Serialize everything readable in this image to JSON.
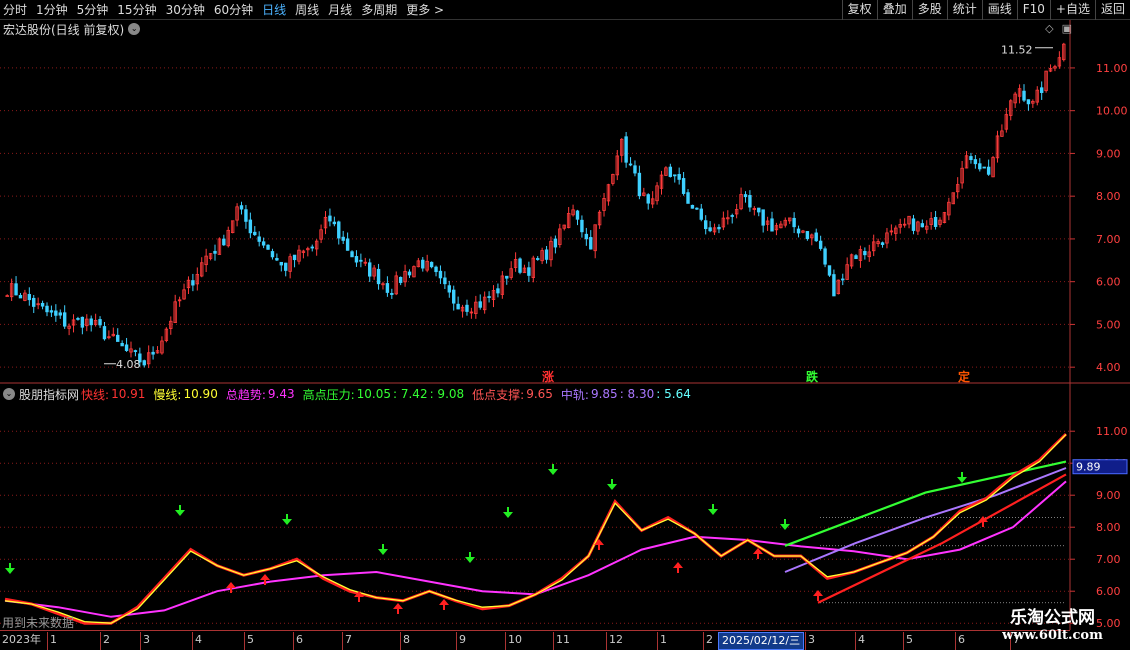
{
  "toolbar": {
    "periods": [
      {
        "label": "分时",
        "active": false
      },
      {
        "label": "1分钟",
        "active": false
      },
      {
        "label": "5分钟",
        "active": false
      },
      {
        "label": "15分钟",
        "active": false
      },
      {
        "label": "30分钟",
        "active": false
      },
      {
        "label": "60分钟",
        "active": false
      },
      {
        "label": "日线",
        "active": true
      },
      {
        "label": "周线",
        "active": false
      },
      {
        "label": "月线",
        "active": false
      },
      {
        "label": "多周期",
        "active": false
      },
      {
        "label": "更多 >",
        "active": false
      }
    ],
    "buttons": [
      "复权",
      "叠加",
      "多股",
      "统计",
      "画线",
      "F10",
      "+自选",
      "返回"
    ]
  },
  "main_chart": {
    "title": "宏达股份(日线 前复权)",
    "high_label": "11.52",
    "low_label": "4.08",
    "event_labels": [
      {
        "text": "涨",
        "color": "#ff3030"
      },
      {
        "text": "跌",
        "color": "#33ff33"
      },
      {
        "text": "定",
        "color": "#ff5500"
      }
    ]
  },
  "indicator": {
    "name": "股朋指标网",
    "fast_label": "快线:",
    "fast_value": "10.91",
    "slow_label": "慢线:",
    "slow_value": "10.90",
    "trend_label": "总趋势:",
    "trend_value": "9.43",
    "press_label": "高点压力:",
    "press_value": "10.05",
    "press_value2": ": 7.42",
    "press_value3": ": 9.08",
    "support_label": "低点支撑:",
    "support_value": "9.65",
    "mid_label": "中轨:",
    "mid_value": "9.85",
    "mid_value2": ": 8.30",
    "mid_value3": ": 5.64",
    "current_tag": "9.89",
    "future_note": "用到未来数据"
  },
  "date_axis": {
    "ticks": [
      "2023年",
      "1",
      "2",
      "3",
      "4",
      "5",
      "6",
      "7",
      "8",
      "9",
      "10",
      "11",
      "12",
      "1",
      "2",
      "3",
      "4",
      "5",
      "6",
      "7"
    ],
    "cursor_date": "2025/02/12/三"
  },
  "watermark": {
    "title": "乐淘公式网",
    "url": "www.60lt.com"
  },
  "chart_data": [
    {
      "type": "candlestick",
      "title": "宏达股份(日线 前复权)",
      "ylim": [
        3.7,
        11.7
      ],
      "yticks": [
        4.0,
        5.0,
        6.0,
        7.0,
        8.0,
        9.0,
        10.0,
        11.0
      ],
      "grid": true,
      "close_path": [
        5.85,
        5.7,
        5.4,
        5.2,
        5.0,
        5.1,
        4.9,
        4.6,
        4.3,
        4.1,
        4.6,
        5.4,
        6.0,
        6.6,
        6.9,
        7.7,
        7.2,
        6.8,
        6.3,
        6.6,
        6.8,
        7.5,
        6.9,
        6.4,
        6.2,
        5.8,
        6.2,
        6.5,
        6.1,
        5.6,
        5.45,
        5.5,
        5.8,
        6.4,
        6.3,
        6.6,
        7.0,
        7.8,
        6.8,
        7.9,
        9.3,
        8.4,
        7.6,
        8.7,
        8.2,
        7.6,
        7.1,
        7.5,
        7.9,
        7.5,
        7.3,
        7.35,
        7.2,
        6.9,
        5.7,
        6.6,
        6.7,
        7.0,
        7.1,
        7.4,
        7.2,
        7.6,
        8.4,
        9.0,
        8.5,
        9.6,
        10.6,
        10.1,
        10.9,
        11.52
      ],
      "high": 11.52,
      "low": 4.08,
      "annotations": [
        "涨",
        "跌",
        "定"
      ]
    },
    {
      "type": "line",
      "title": "股朋指标网",
      "ylim": [
        4.85,
        11.85
      ],
      "yticks": [
        5.0,
        6.0,
        7.0,
        8.0,
        9.0,
        10.0,
        11.0
      ],
      "series": [
        {
          "name": "快线",
          "color": "#ff2020",
          "values": [
            5.75,
            5.6,
            5.3,
            5.0,
            5.0,
            5.5,
            6.4,
            7.3,
            6.8,
            6.5,
            6.7,
            7.0,
            6.4,
            6.0,
            5.8,
            5.7,
            6.0,
            5.7,
            5.45,
            5.55,
            5.9,
            6.4,
            7.1,
            8.8,
            7.9,
            8.3,
            7.8,
            7.1,
            7.6,
            7.1,
            7.1,
            6.4,
            6.6,
            6.9,
            7.2,
            7.7,
            8.5,
            8.9,
            9.6,
            10.1,
            10.91
          ]
        },
        {
          "name": "慢线",
          "color": "#ffff30",
          "values": [
            5.7,
            5.6,
            5.35,
            5.05,
            5.0,
            5.45,
            6.35,
            7.25,
            6.8,
            6.5,
            6.7,
            6.95,
            6.45,
            6.05,
            5.8,
            5.7,
            6.0,
            5.72,
            5.5,
            5.55,
            5.9,
            6.35,
            7.1,
            8.75,
            7.9,
            8.25,
            7.8,
            7.1,
            7.6,
            7.1,
            7.1,
            6.45,
            6.6,
            6.9,
            7.2,
            7.7,
            8.45,
            8.85,
            9.55,
            10.05,
            10.9
          ]
        },
        {
          "name": "总趋势",
          "color": "#ff33ff",
          "values": [
            5.7,
            5.5,
            5.2,
            5.4,
            6.0,
            6.3,
            6.5,
            6.6,
            6.3,
            6.0,
            5.9,
            6.5,
            7.3,
            7.7,
            7.6,
            7.4,
            7.25,
            7.0,
            7.3,
            8.0,
            9.43
          ]
        },
        {
          "name": "中轨",
          "color": "#aa77ff",
          "values": [
            6.6,
            7.5,
            8.3,
            9.0,
            9.85
          ]
        },
        {
          "name": "高点压力",
          "color": "#33ff33",
          "values": [
            7.42,
            9.08,
            10.05
          ]
        },
        {
          "name": "低点支撑",
          "color": "#ff2020",
          "values": [
            5.64,
            7.5,
            9.65
          ]
        }
      ]
    }
  ]
}
